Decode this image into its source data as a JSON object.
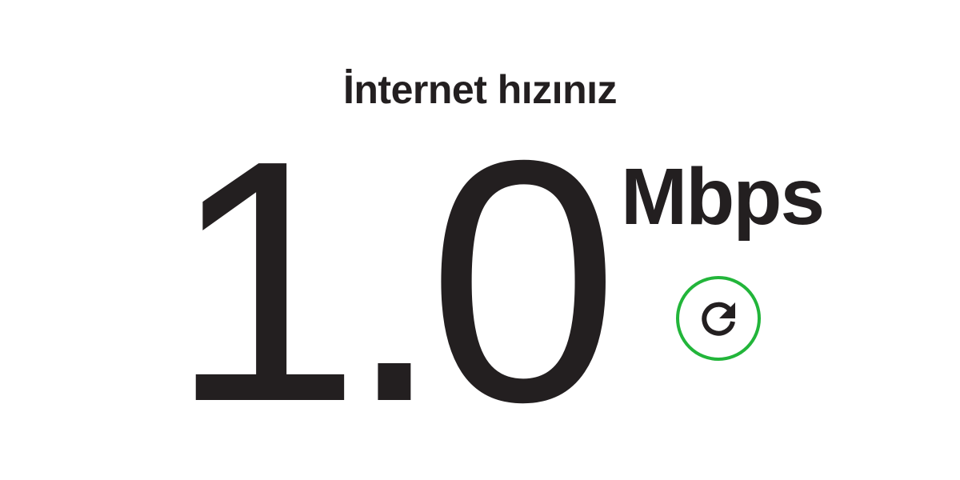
{
  "heading": "İnternet hızınız",
  "speed": {
    "value": "1.0",
    "unit": "Mbps"
  },
  "refresh_button": {
    "icon": "refresh-icon",
    "ring_color": "#22b53a"
  },
  "colors": {
    "text": "#231f20",
    "background": "#ffffff",
    "accent": "#22b53a"
  }
}
